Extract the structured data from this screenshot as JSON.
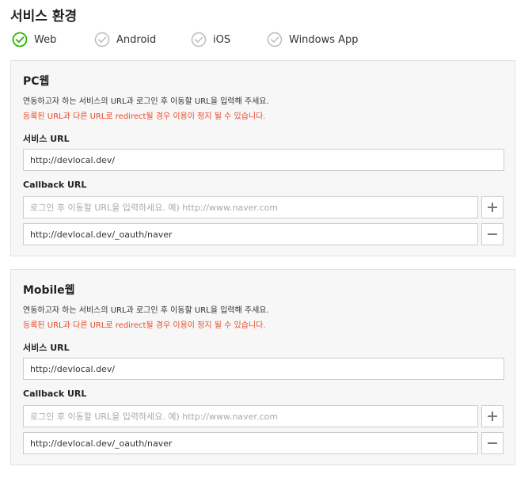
{
  "page_title": "서비스 환경",
  "platforms": [
    {
      "label": "Web",
      "checked": true,
      "icon": "check-circle-icon"
    },
    {
      "label": "Android",
      "checked": false,
      "icon": "check-circle-icon"
    },
    {
      "label": "iOS",
      "checked": false,
      "icon": "check-circle-icon"
    },
    {
      "label": "Windows App",
      "checked": false,
      "icon": "check-circle-icon"
    }
  ],
  "colors": {
    "check_active": "#2db400",
    "check_inactive": "#bbbbbb",
    "warning": "#e8492a"
  },
  "pc": {
    "title": "PC웹",
    "description": "연동하고자 하는 서비스의 URL과 로그인 후 이동할 URL을 입력해 주세요.",
    "warning": "등록된 URL과 다른 URL로 redirect될 경우 이용이 정지 될 수 있습니다.",
    "service_url_label": "서비스 URL",
    "service_url_value": "http://devlocal.dev/",
    "callback_label": "Callback URL",
    "callback_placeholder": "로그인 후 이동할 URL을 입력하세요. 예) http://www.naver.com",
    "callback_value": "http://devlocal.dev/_oauth/naver"
  },
  "mobile": {
    "title": "Mobile웹",
    "description": "연동하고자 하는 서비스의 URL과 로그인 후 이동할 URL을 입력해 주세요.",
    "warning": "등록된 URL과 다른 URL로 redirect될 경우 이용이 정지 될 수 있습니다.",
    "service_url_label": "서비스 URL",
    "service_url_value": "http://devlocal.dev/",
    "callback_label": "Callback URL",
    "callback_placeholder": "로그인 후 이동할 URL을 입력하세요. 예) http://www.naver.com",
    "callback_value": "http://devlocal.dev/_oauth/naver"
  }
}
